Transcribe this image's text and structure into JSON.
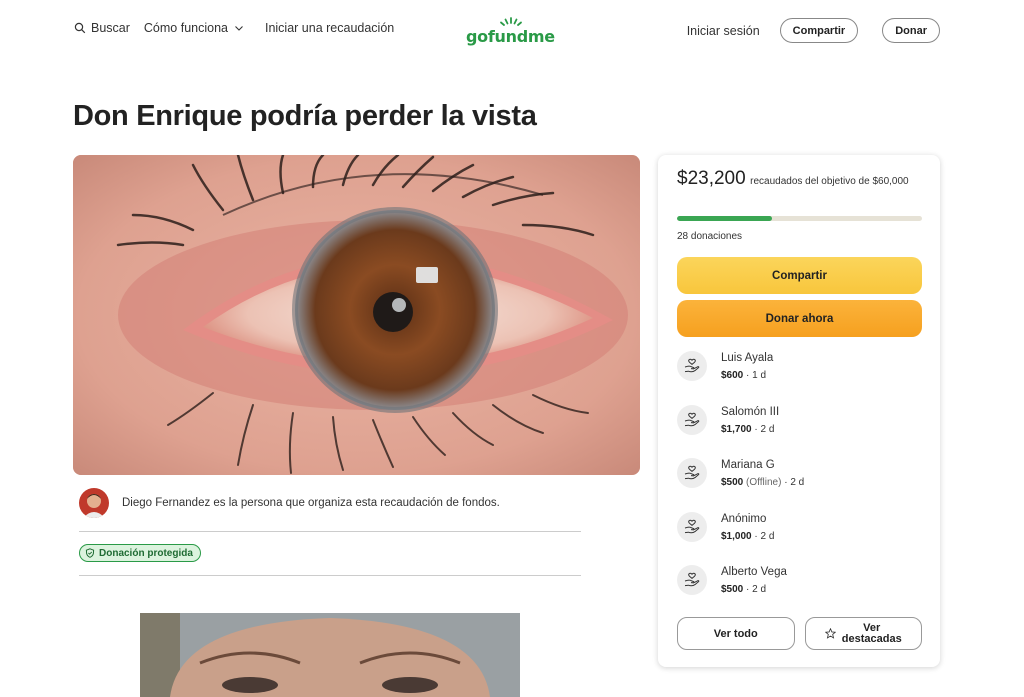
{
  "header": {
    "search": "Buscar",
    "how_it_works": "Cómo funciona",
    "start": "Iniciar una recaudación",
    "logo": "gofundme",
    "signin": "Iniciar sesión",
    "share": "Compartir",
    "donate": "Donar"
  },
  "campaign": {
    "title": "Don Enrique podría perder la vista",
    "organizer_text": "Diego Fernandez es la persona que organiza esta recaudación de fondos.",
    "protected_badge": "Donación protegida"
  },
  "card": {
    "raised_amount": "$23,200",
    "raised_text": "recaudados del objetivo de $60,000",
    "progress_fraction": 0.387,
    "donations_count": "28 donaciones",
    "share_button": "Compartir",
    "donate_button": "Donar ahora",
    "donors": [
      {
        "name": "Luis Ayala",
        "amount": "$600",
        "note": "",
        "time": "1 d"
      },
      {
        "name": "Salomón III",
        "amount": "$1,700",
        "note": "",
        "time": "2 d"
      },
      {
        "name": "Mariana G",
        "amount": "$500",
        "note": "(Offline)",
        "time": "2 d"
      },
      {
        "name": "Anónimo",
        "amount": "$1,000",
        "note": "",
        "time": "2 d"
      },
      {
        "name": "Alberto Vega",
        "amount": "$500",
        "note": "",
        "time": "2 d"
      }
    ],
    "see_all": "Ver todo",
    "see_featured": "Ver destacadas"
  },
  "colors": {
    "brand_green": "#2a9a47",
    "progress_green": "#3aa653",
    "share_yellow": "#f8c63c",
    "donate_orange": "#f6a01f"
  }
}
